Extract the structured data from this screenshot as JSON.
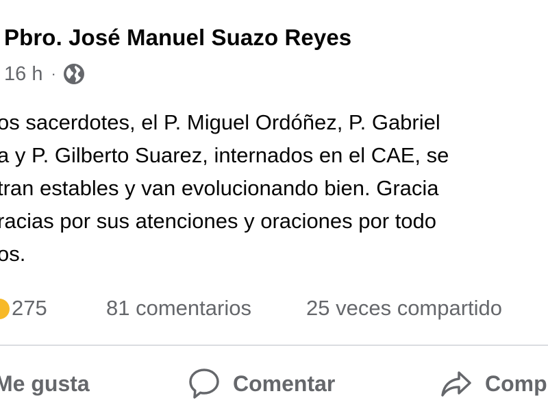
{
  "post": {
    "author": "Pbro. José Manuel Suazo Reyes",
    "time": "16 h",
    "separator": "·",
    "privacy_icon": "globe-icon",
    "body_lines": [
      "os sacerdotes, el P. Miguel Ordóñez, P. Gabriel",
      "a y P. Gilberto Suarez, internados en el CAE, se",
      "tran estables y van evolucionando bien. Gracia",
      "racias por sus atenciones y oraciones por todo",
      "os."
    ]
  },
  "stats": {
    "reaction_icon": "reaction-emoji-icon",
    "reactions": "275",
    "comments": "81 comentarios",
    "shares": "25 veces compartido"
  },
  "actions": {
    "like_label": "Me gusta",
    "comment_label": "Comentar",
    "comment_icon": "comment-bubble-icon",
    "share_label": "Comp",
    "share_icon": "share-arrow-icon"
  },
  "colors": {
    "text_primary": "#050505",
    "text_secondary": "#65676b",
    "reaction_yellow": "#f7b928",
    "divider": "#dadde1"
  }
}
